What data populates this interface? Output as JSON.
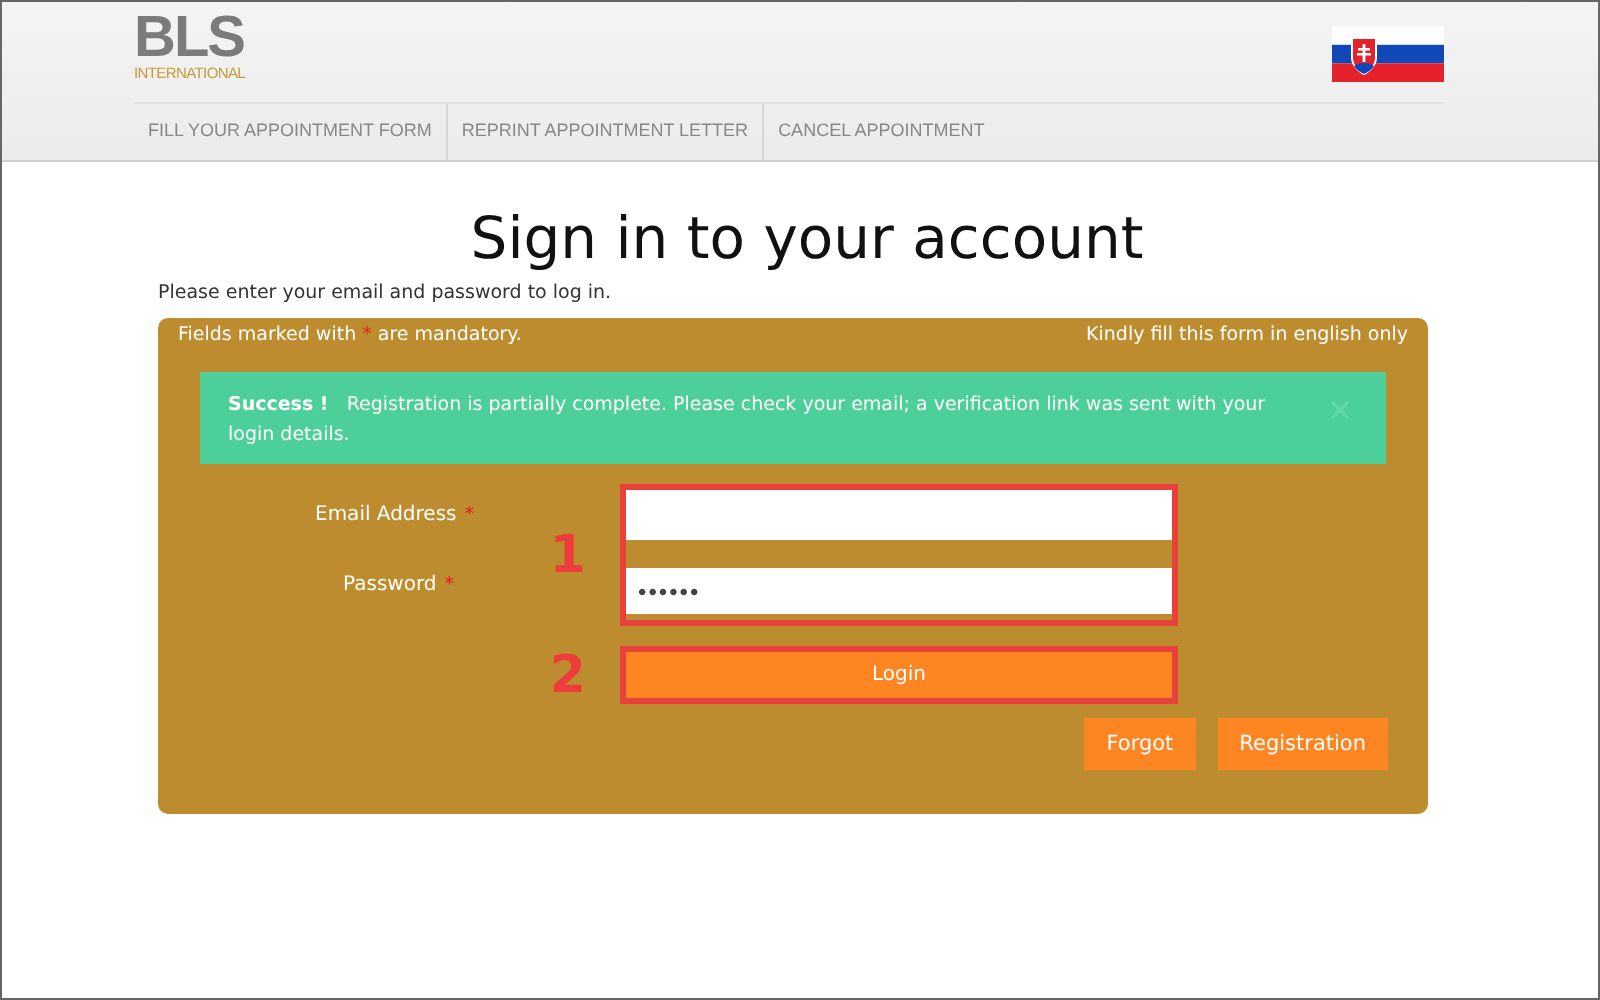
{
  "header": {
    "logo": {
      "mark": "BLS",
      "subtitle": "INTERNATIONAL"
    },
    "nav": [
      {
        "label": "FILL YOUR APPOINTMENT FORM"
      },
      {
        "label": "REPRINT APPOINTMENT LETTER"
      },
      {
        "label": "CANCEL APPOINTMENT"
      }
    ]
  },
  "title": "Sign in to your account",
  "intro": "Please enter your email and password to log in.",
  "panel": {
    "mandatory_note": {
      "before": "Fields marked with",
      "mark": "*",
      "after": "are mandatory."
    },
    "language_note": "Kindly fill this form in english only",
    "alert": {
      "title": "Success !",
      "message": "Registration is partially complete. Please check your email; a verification link was sent with your login details."
    },
    "fields": [
      {
        "label": "Email Address",
        "required_mark": "*",
        "kind": "text"
      },
      {
        "label": "Password",
        "required_mark": "*",
        "kind": "password",
        "value": "••••••"
      }
    ],
    "login_button": "Login",
    "buttons": [
      "Forgot",
      "Registration"
    ]
  },
  "annotations": [
    {
      "label": "1"
    },
    {
      "label": "2"
    }
  ]
}
